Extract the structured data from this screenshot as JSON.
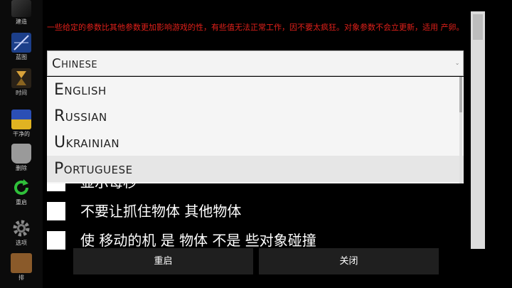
{
  "toolbar": {
    "items": [
      {
        "label": "建造",
        "icon": "build-icon"
      },
      {
        "label": "蓝图",
        "icon": "blueprint-icon"
      },
      {
        "label": "时间",
        "icon": "hourglass-icon"
      },
      {
        "label": "干净的",
        "icon": "clean-icon"
      },
      {
        "label": "删除",
        "icon": "delete-icon"
      },
      {
        "label": "重启",
        "icon": "restart-icon"
      },
      {
        "label": "选项",
        "icon": "gear-icon"
      },
      {
        "label": "排",
        "icon": "box-icon"
      }
    ]
  },
  "dialog": {
    "warning": "一些给定的参数比其他参数更加影响游戏的性，有些值无法正常工作，因不要太疯狂。对象参数不会立更新，适用 产卵。",
    "language": {
      "selected": "Chinese",
      "options": [
        "English",
        "Russian",
        "Ukrainian",
        "Portuguese"
      ],
      "highlighted_index": 3
    },
    "checkboxes": [
      {
        "label": "显示每秒"
      },
      {
        "label": "不要让抓住物体  其他物体"
      },
      {
        "label": "使  移动的机  是  物体 不是   些对象碰撞"
      }
    ],
    "buttons": {
      "restart": "重启",
      "close": "关闭"
    }
  },
  "colors": {
    "background": "#000000",
    "warning_text": "#e0201a",
    "button_bg": "#1f1f1f",
    "dropdown_bg": "#f5f5f5"
  }
}
